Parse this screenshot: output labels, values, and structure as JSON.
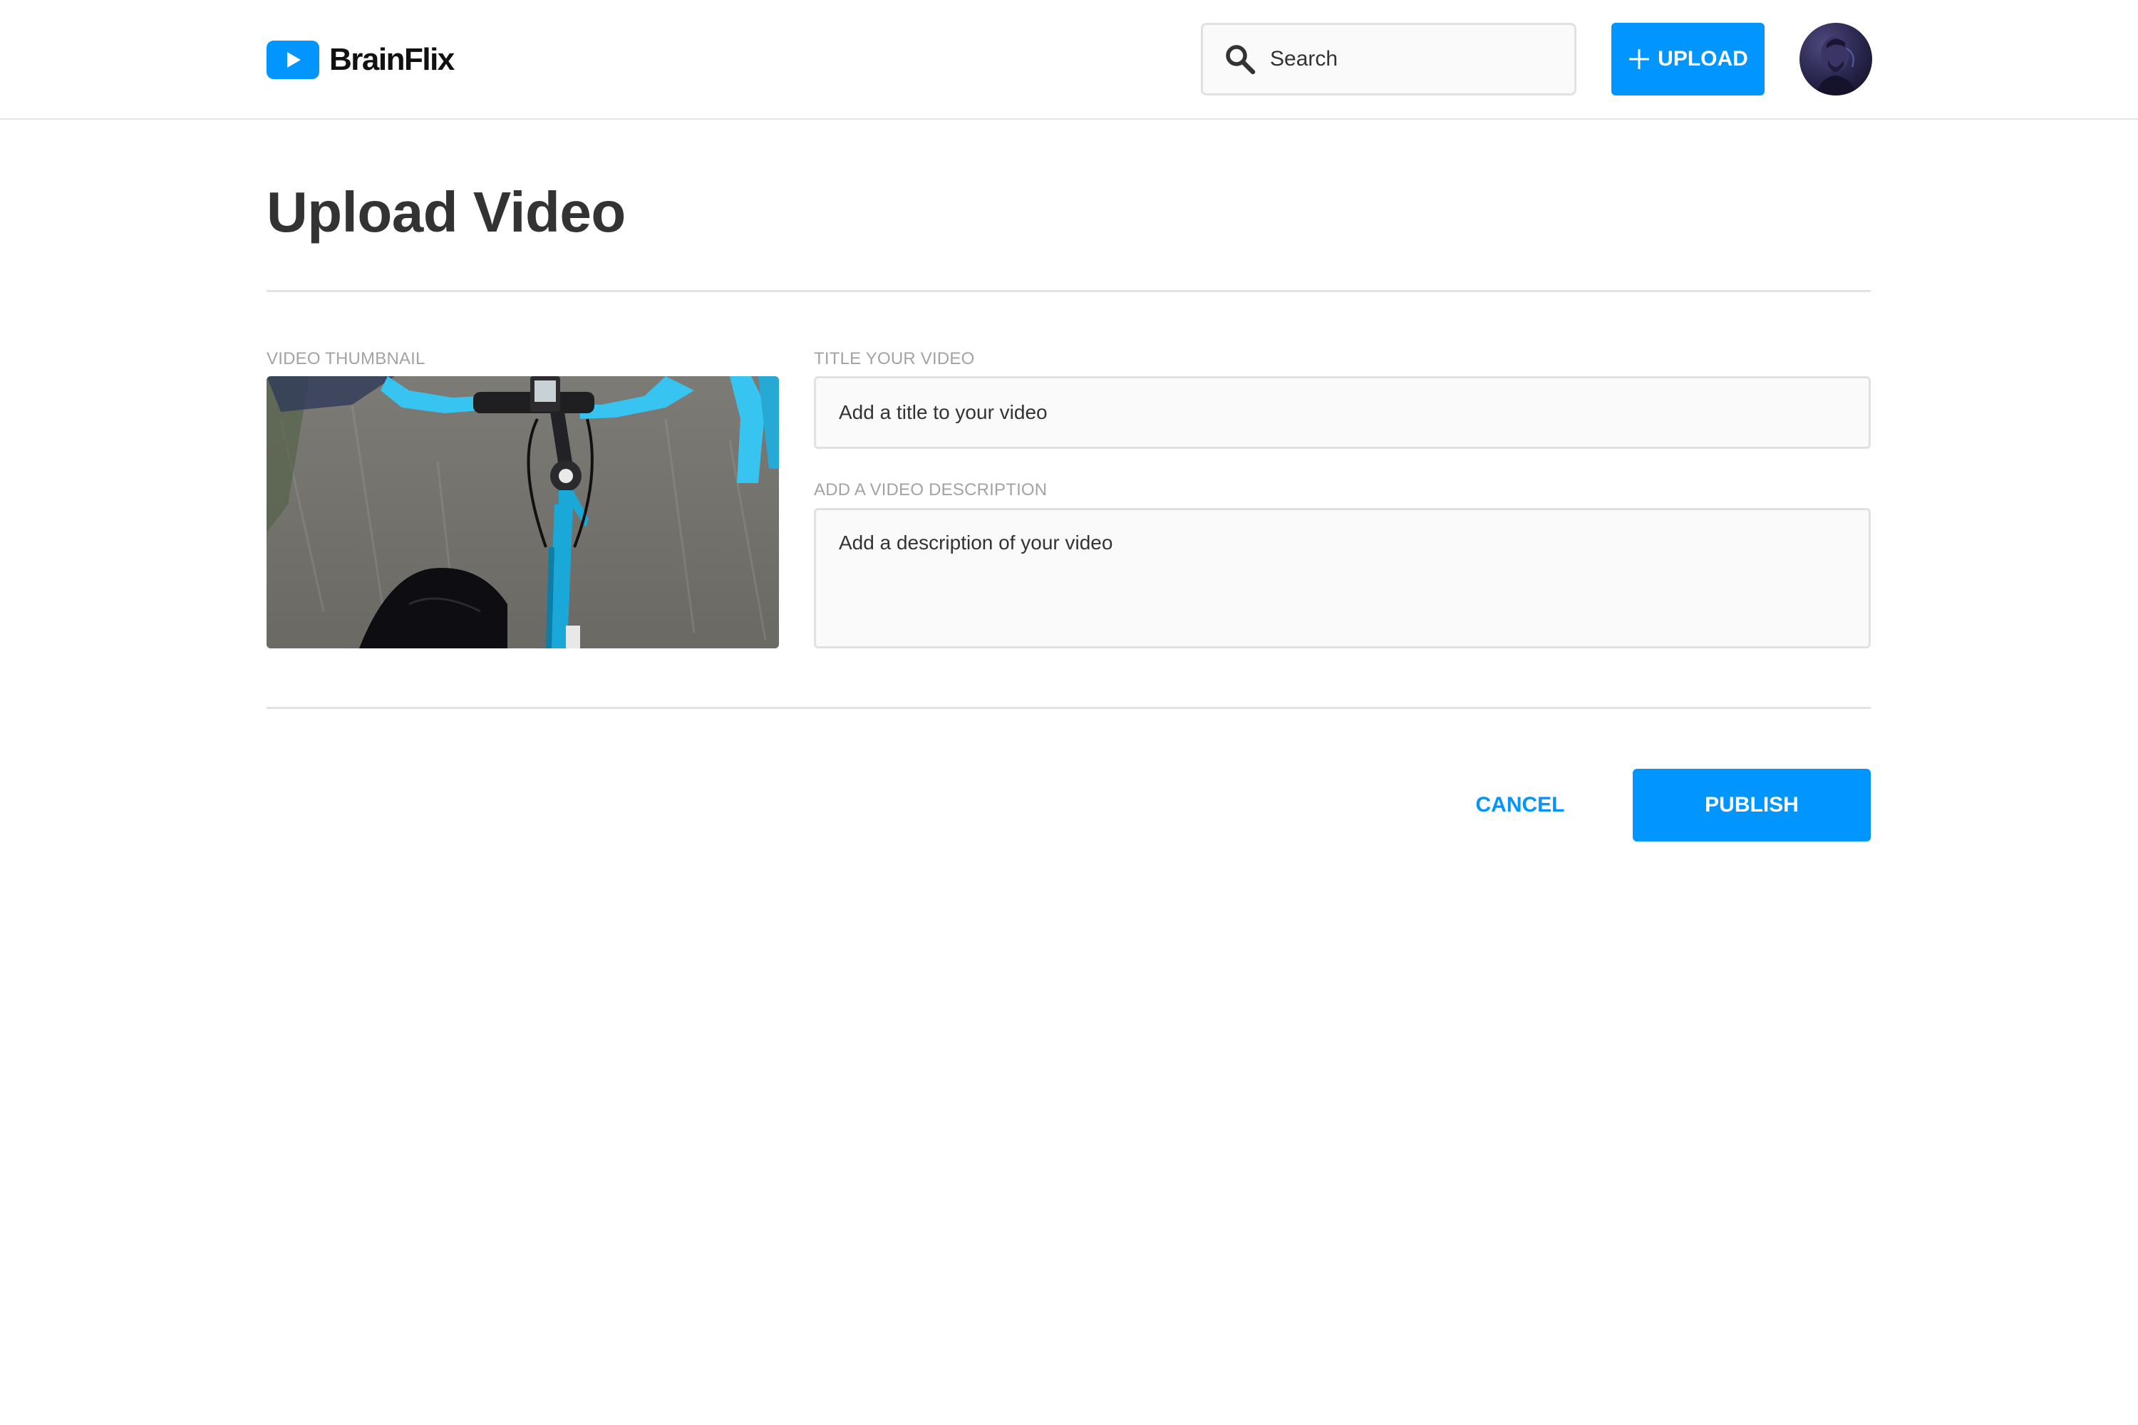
{
  "header": {
    "brand": "BrainFlix",
    "search_placeholder": "Search",
    "upload_label": "UPLOAD",
    "avatar_icon": "user-avatar-icon"
  },
  "main": {
    "title": "Upload Video",
    "thumbnail_label": "VIDEO THUMBNAIL",
    "title_label": "TITLE YOUR VIDEO",
    "title_placeholder": "Add a title to your video",
    "description_label": "ADD A VIDEO DESCRIPTION",
    "description_placeholder": "Add a description of your video",
    "cancel_label": "CANCEL",
    "publish_label": "PUBLISH"
  },
  "colors": {
    "accent": "#0095ff",
    "title_text": "#333333",
    "label_text": "#a3a3a3",
    "input_bg": "#fafafa",
    "input_border": "#e1e1e1",
    "bike_frame": "#1aa8d9",
    "bar_tape": "#38c4f0"
  }
}
